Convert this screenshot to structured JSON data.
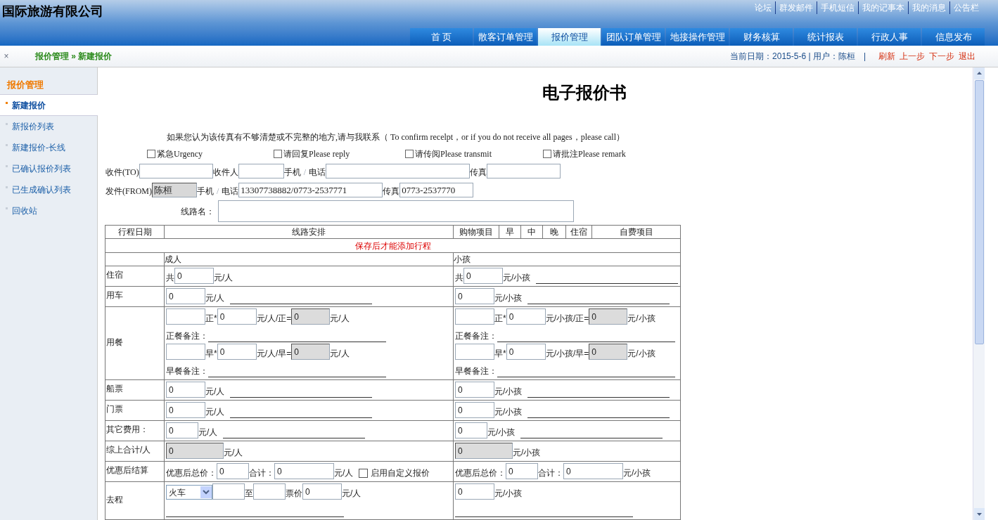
{
  "app": {
    "title": "国际旅游有限公司"
  },
  "top_links": [
    "论坛",
    "群发邮件",
    "手机短信",
    "我的记事本",
    "我的消息",
    "公告栏"
  ],
  "nav": [
    {
      "label": "首 页",
      "selected": false
    },
    {
      "label": "散客订单管理",
      "selected": false
    },
    {
      "label": "报价管理",
      "selected": true
    },
    {
      "label": "团队订单管理",
      "selected": false
    },
    {
      "label": "地接操作管理",
      "selected": false
    },
    {
      "label": "财务核算",
      "selected": false
    },
    {
      "label": "统计报表",
      "selected": false
    },
    {
      "label": "行政人事",
      "selected": false
    },
    {
      "label": "信息发布",
      "selected": false
    }
  ],
  "breadcrumb": {
    "close": "×",
    "path": "报价管理 » 新建报价"
  },
  "status": {
    "info": "当前日期：2015-5-6 | 用户：陈桓",
    "separator": "|",
    "actions": [
      "刷新",
      "上一步",
      "下一步",
      "退出"
    ]
  },
  "sidebar": {
    "title": "报价管理",
    "items": [
      {
        "label": "新建报价",
        "selected": true
      },
      {
        "label": "新报价列表",
        "selected": false
      },
      {
        "label": "新建报价-长线",
        "selected": false
      },
      {
        "label": "已确认报价列表",
        "selected": false
      },
      {
        "label": "已生成确认列表",
        "selected": false
      },
      {
        "label": "回收站",
        "selected": false
      }
    ]
  },
  "form": {
    "title": "电子报价书",
    "note": "如果您认为该传真有不够清楚或不完整的地方,请与我联系（ To confirm recelpt，or if you do not receive all pages，please call）",
    "flags": [
      {
        "label": "紧急Urgency",
        "checked": false
      },
      {
        "label": "请回复Please reply",
        "checked": false
      },
      {
        "label": "请传阅Please transmit",
        "checked": false
      },
      {
        "label": "请批注Please remark",
        "checked": false
      }
    ],
    "recipient_row": [
      {
        "kind": "text",
        "text": "收件(TO)"
      },
      {
        "kind": "field"
      },
      {
        "kind": "text",
        "text": "收件人"
      },
      {
        "kind": "field_short"
      },
      {
        "kind": "text",
        "text": "手机"
      },
      {
        "kind": "faint",
        "text": "/"
      },
      {
        "kind": "text",
        "text": "电话"
      },
      {
        "kind": "field_wide"
      },
      {
        "kind": "text",
        "text": "传真"
      },
      {
        "kind": "field"
      }
    ],
    "sender_row": [
      {
        "kind": "text",
        "text": "发件(FROM)"
      },
      {
        "kind": "locked",
        "value": "陈桓"
      },
      {
        "kind": "text",
        "text": "手机"
      },
      {
        "kind": "faint",
        "text": "/"
      },
      {
        "kind": "text",
        "text": "电话"
      },
      {
        "kind": "field_wide",
        "value": "13307738882/0773-2537771"
      },
      {
        "kind": "text",
        "text": "传真"
      },
      {
        "kind": "field",
        "value": "0773-2537770"
      }
    ],
    "route_name": {
      "label": "线路名："
    }
  },
  "table": {
    "columns": [
      "行程日期",
      "线路安排",
      "购物项目",
      "早",
      "中",
      "晚",
      "住宿",
      "自费项目"
    ],
    "notice": "保存后才能添加行程",
    "groups": [
      "成人",
      "小孩"
    ],
    "rows": [
      {
        "label": "住宿",
        "adult": [
          {
            "kind": "text",
            "text": "共"
          },
          {
            "kind": "amount",
            "value": "0"
          },
          {
            "kind": "text",
            "text": "元/人"
          }
        ],
        "child": [
          {
            "kind": "text",
            "text": "共"
          },
          {
            "kind": "amount",
            "value": "0"
          },
          {
            "kind": "text",
            "text": "元/小孩"
          },
          {
            "kind": "line"
          }
        ]
      },
      {
        "label": "用车",
        "adult": [
          {
            "kind": "amount",
            "value": "0"
          },
          {
            "kind": "text",
            "text": "元/人"
          },
          {
            "kind": "line"
          }
        ],
        "child": [
          {
            "kind": "amount",
            "value": "0"
          },
          {
            "kind": "text",
            "text": "元/小孩"
          },
          {
            "kind": "line"
          }
        ]
      },
      {
        "label": "用餐",
        "adult": [
          {
            "kind": "amount"
          },
          {
            "kind": "text",
            "text": "正*"
          },
          {
            "kind": "amount",
            "value": "0"
          },
          {
            "kind": "text",
            "text": "元/人/正="
          },
          {
            "kind": "total",
            "value": "0"
          },
          {
            "kind": "text",
            "text": "元/人"
          },
          {
            "kind": "br"
          },
          {
            "kind": "text",
            "text": "正餐备注："
          },
          {
            "kind": "note_line"
          },
          {
            "kind": "br"
          },
          {
            "kind": "amount"
          },
          {
            "kind": "text",
            "text": "早*"
          },
          {
            "kind": "amount",
            "value": "0"
          },
          {
            "kind": "text",
            "text": "元/人/早="
          },
          {
            "kind": "total",
            "value": "0"
          },
          {
            "kind": "text",
            "text": "元/人"
          },
          {
            "kind": "br"
          },
          {
            "kind": "text",
            "text": "早餐备注："
          },
          {
            "kind": "note_line"
          }
        ],
        "child": [
          {
            "kind": "amount"
          },
          {
            "kind": "text",
            "text": "正*"
          },
          {
            "kind": "amount",
            "value": "0"
          },
          {
            "kind": "text",
            "text": "元/小孩/正="
          },
          {
            "kind": "total",
            "value": "0"
          },
          {
            "kind": "text",
            "text": "元/小孩"
          },
          {
            "kind": "br"
          },
          {
            "kind": "text",
            "text": "正餐备注："
          },
          {
            "kind": "note_line"
          },
          {
            "kind": "br"
          },
          {
            "kind": "amount"
          },
          {
            "kind": "text",
            "text": "早*"
          },
          {
            "kind": "amount",
            "value": "0"
          },
          {
            "kind": "text",
            "text": "元/小孩/早="
          },
          {
            "kind": "total",
            "value": "0"
          },
          {
            "kind": "text",
            "text": "元/小孩"
          },
          {
            "kind": "br"
          },
          {
            "kind": "text",
            "text": "早餐备注："
          },
          {
            "kind": "note_line"
          }
        ]
      },
      {
        "label": "船票",
        "adult": [
          {
            "kind": "amount",
            "value": "0"
          },
          {
            "kind": "text",
            "text": "元/人"
          },
          {
            "kind": "line"
          }
        ],
        "child": [
          {
            "kind": "amount",
            "value": "0"
          },
          {
            "kind": "text",
            "text": "元/小孩"
          },
          {
            "kind": "line"
          }
        ]
      },
      {
        "label": "门票",
        "adult": [
          {
            "kind": "amount",
            "value": "0"
          },
          {
            "kind": "text",
            "text": "元/人"
          },
          {
            "kind": "line"
          }
        ],
        "child": [
          {
            "kind": "amount",
            "value": "0"
          },
          {
            "kind": "text",
            "text": "元/小孩"
          },
          {
            "kind": "line"
          }
        ]
      },
      {
        "label": "其它费用：",
        "adult": [
          {
            "kind": "amount_short",
            "value": "0"
          },
          {
            "kind": "text",
            "text": "元/人"
          },
          {
            "kind": "line"
          }
        ],
        "child": [
          {
            "kind": "amount_short",
            "value": "0"
          },
          {
            "kind": "text",
            "text": "元/小孩"
          },
          {
            "kind": "line"
          }
        ]
      },
      {
        "label": "综上合计/人",
        "adult": [
          {
            "kind": "sum",
            "value": "0"
          },
          {
            "kind": "text",
            "text": "元/人"
          }
        ],
        "child": [
          {
            "kind": "sum",
            "value": "0"
          },
          {
            "kind": "text",
            "text": "元/小孩"
          }
        ]
      },
      {
        "label": "优惠后结算",
        "adult": [
          {
            "kind": "text",
            "text": "优惠后总价："
          },
          {
            "kind": "amount_short",
            "value": "0"
          },
          {
            "kind": "text",
            "text": "合计："
          },
          {
            "kind": "amount_wide",
            "value": "0"
          },
          {
            "kind": "text",
            "text": "元/人"
          },
          {
            "kind": "check",
            "text": "启用自定义报价",
            "checked": false
          }
        ],
        "child": [
          {
            "kind": "text",
            "text": "优惠后总价："
          },
          {
            "kind": "amount_short",
            "value": "0"
          },
          {
            "kind": "text",
            "text": "合计："
          },
          {
            "kind": "amount_wide",
            "value": "0"
          },
          {
            "kind": "text",
            "text": "元/小孩"
          }
        ]
      },
      {
        "label": "去程",
        "adult": [
          {
            "kind": "select",
            "value": "火车"
          },
          {
            "kind": "amount_short"
          },
          {
            "kind": "text",
            "text": "至"
          },
          {
            "kind": "amount_short"
          },
          {
            "kind": "text",
            "text": "票价"
          },
          {
            "kind": "amount",
            "value": "0"
          },
          {
            "kind": "text",
            "text": "元/人"
          },
          {
            "kind": "br"
          },
          {
            "kind": "note_line"
          }
        ],
        "child": [
          {
            "kind": "amount",
            "value": "0"
          },
          {
            "kind": "text",
            "text": "元/小孩"
          },
          {
            "kind": "br"
          },
          {
            "kind": "note_line"
          }
        ]
      }
    ]
  }
}
